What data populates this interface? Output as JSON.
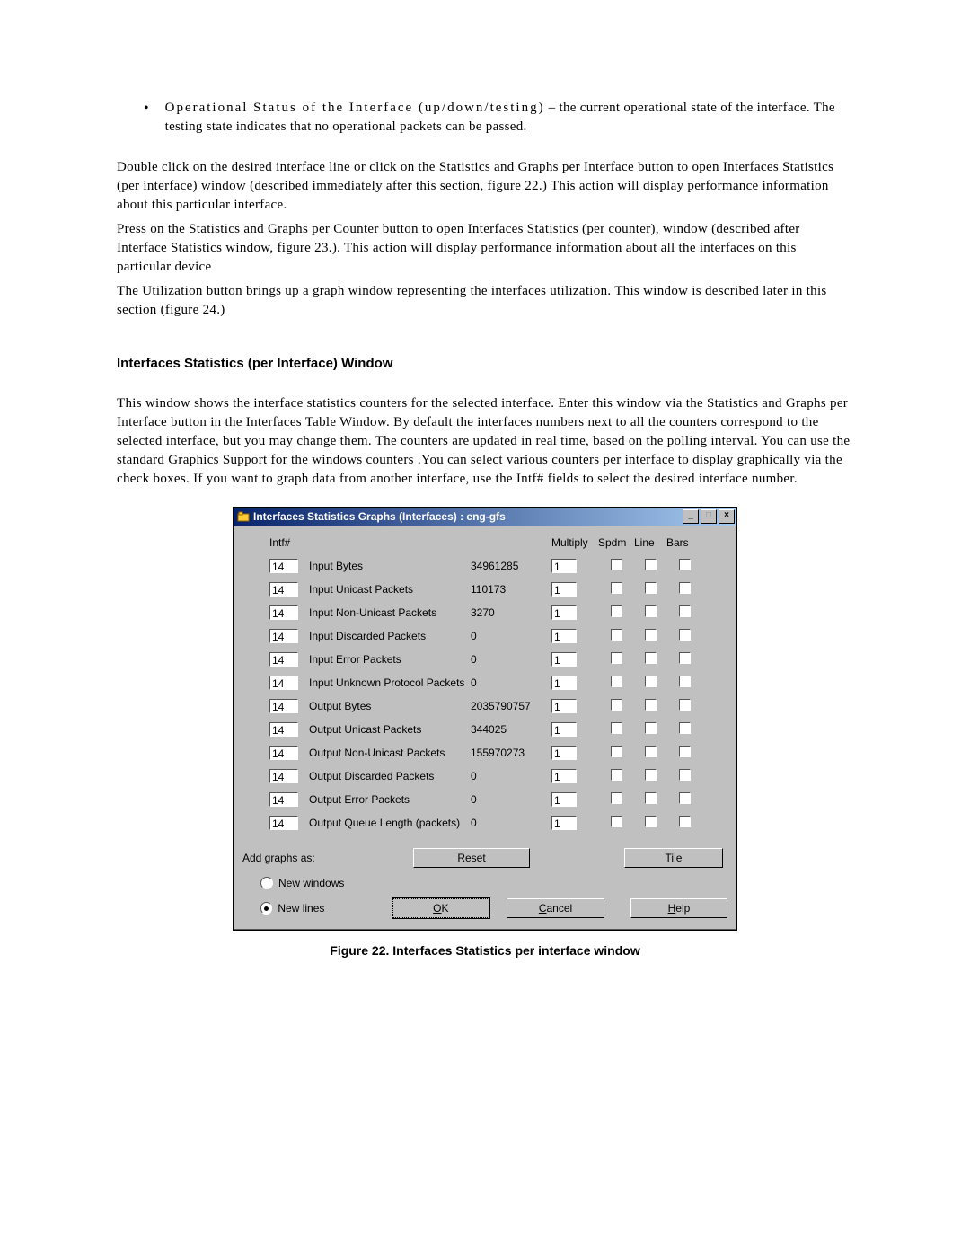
{
  "bullet": {
    "prefix_spaced": "Operational Status of the Interface (up/down/testing)",
    "text_rest": " – the current operational state of the interface. The testing state indicates that no operational packets can be passed."
  },
  "para1": "Double click on the desired interface line or click on the Statistics and Graphs per Interface button to open Interfaces Statistics (per interface) window (described immediately after this section, figure 22.) This action will display performance information about this particular interface.",
  "para2": "Press on the Statistics and Graphs per Counter button to open Interfaces Statistics (per counter), window (described after Interface Statistics window, figure 23.). This action will display performance information about all the interfaces on this particular device",
  "para3": "The Utilization button brings up a graph window representing the interfaces utilization. This window is described later in this section (figure 24.)",
  "heading": "Interfaces Statistics (per Interface) Window",
  "body1": "This window shows the interface statistics counters for the selected interface. Enter this window via the Statistics and Graphs per Interface button in the Interfaces Table Window. By default the interfaces numbers next to all the counters correspond to the selected interface, but you may change them. The counters are updated in real time, based on the polling interval. You can use the standard Graphics Support for the windows counters .You can select various counters per interface to display graphically via the check boxes. If you want to graph data from another interface, use the Intf# fields to select the desired interface number.",
  "caption": "Figure 22. Interfaces Statistics per interface window",
  "window": {
    "title": "Interfaces Statistics Graphs (Interfaces) : eng-gfs",
    "headers": {
      "intf": "Intf#",
      "multiply": "Multiply",
      "spdm": "Spdm",
      "line": "Line",
      "bars": "Bars"
    },
    "rows": [
      {
        "intf": "14",
        "name": "Input Bytes",
        "value": "34961285",
        "mult": "1"
      },
      {
        "intf": "14",
        "name": "Input Unicast Packets",
        "value": "110173",
        "mult": "1"
      },
      {
        "intf": "14",
        "name": "Input Non-Unicast Packets",
        "value": "3270",
        "mult": "1"
      },
      {
        "intf": "14",
        "name": "Input Discarded Packets",
        "value": "0",
        "mult": "1"
      },
      {
        "intf": "14",
        "name": "Input Error Packets",
        "value": "0",
        "mult": "1"
      },
      {
        "intf": "14",
        "name": "Input Unknown Protocol Packets",
        "value": "0",
        "mult": "1"
      },
      {
        "intf": "14",
        "name": "Output Bytes",
        "value": "2035790757",
        "mult": "1"
      },
      {
        "intf": "14",
        "name": "Output Unicast Packets",
        "value": "344025",
        "mult": "1"
      },
      {
        "intf": "14",
        "name": "Output Non-Unicast Packets",
        "value": "155970273",
        "mult": "1"
      },
      {
        "intf": "14",
        "name": "Output Discarded Packets",
        "value": "0",
        "mult": "1"
      },
      {
        "intf": "14",
        "name": "Output Error Packets",
        "value": "0",
        "mult": "1"
      },
      {
        "intf": "14",
        "name": "Output Queue Length (packets)",
        "value": "0",
        "mult": "1"
      }
    ],
    "bottom": {
      "add_graphs_as": "Add graphs as:",
      "new_windows": "New windows",
      "new_lines": "New lines",
      "reset": "Reset",
      "tile": "Tile",
      "ok": "OK",
      "cancel": "Cancel",
      "help": "Help"
    }
  }
}
